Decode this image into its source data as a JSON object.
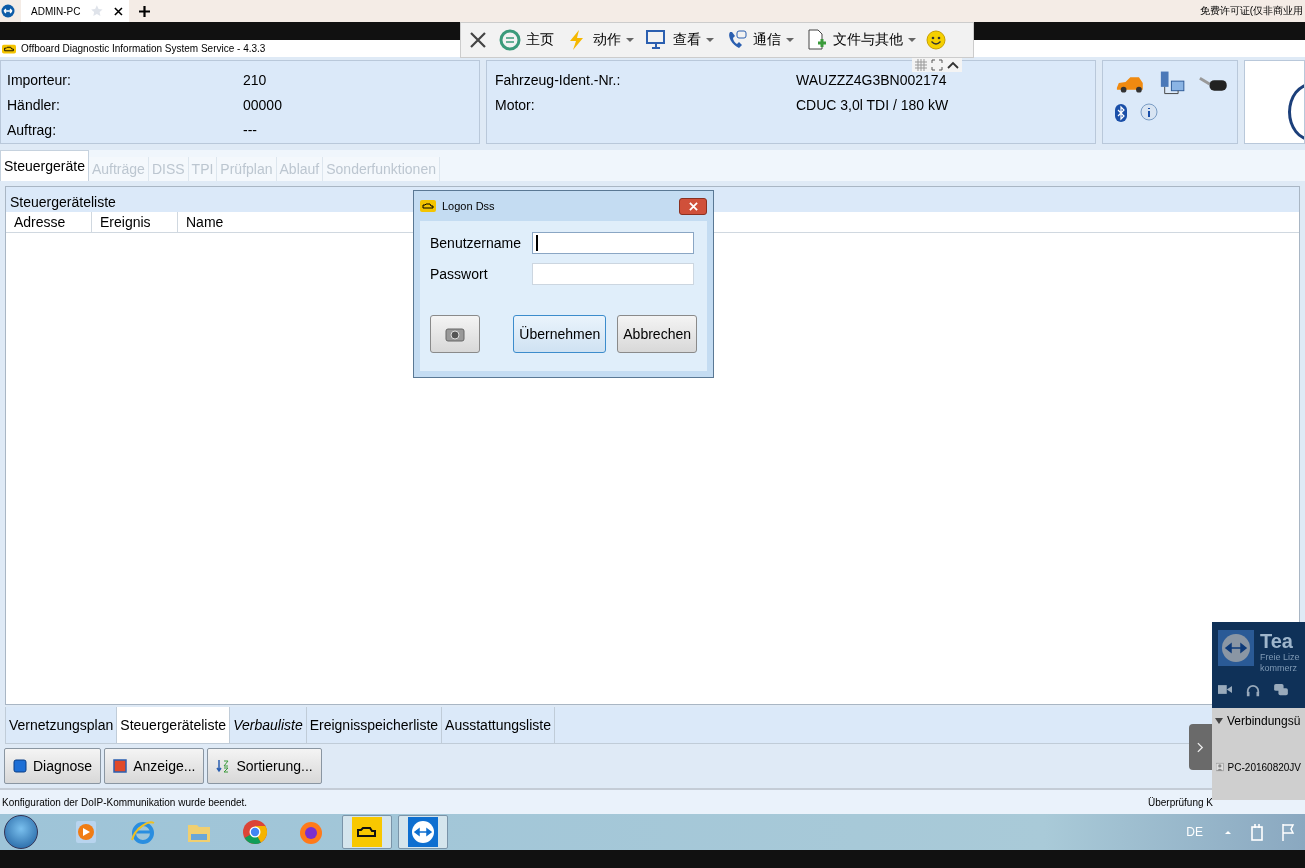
{
  "browser": {
    "tab": "ADMIN-PC",
    "notice": "免费许可证(仅非商业用"
  },
  "remote_toolbar": {
    "items": [
      {
        "label": "主页",
        "dropdown": false
      },
      {
        "label": "动作",
        "dropdown": true
      },
      {
        "label": "查看",
        "dropdown": true
      },
      {
        "label": "通信",
        "dropdown": true
      },
      {
        "label": "文件与其他",
        "dropdown": true
      }
    ]
  },
  "window": {
    "title": "Offboard Diagnostic Information System Service - 4.3.3"
  },
  "order_info": [
    {
      "label": "Importeur:",
      "value": "210"
    },
    {
      "label": "Händler:",
      "value": "00000"
    },
    {
      "label": "Auftrag:",
      "value": "---"
    }
  ],
  "vehicle_info": [
    {
      "label": "Fahrzeug-Ident.-Nr.:",
      "value": "WAUZZZ4G3BN002174"
    },
    {
      "label": "Motor:",
      "value": "CDUC 3,0l TDI / 180 kW"
    }
  ],
  "tabs": [
    {
      "label": "Steuergeräte",
      "selected": true,
      "disabled": false
    },
    {
      "label": "Aufträge",
      "selected": false,
      "disabled": true
    },
    {
      "label": "DISS",
      "selected": false,
      "disabled": true
    },
    {
      "label": "TPI",
      "selected": false,
      "disabled": true
    },
    {
      "label": "Prüfplan",
      "selected": false,
      "disabled": true
    },
    {
      "label": "Ablauf",
      "selected": false,
      "disabled": true
    },
    {
      "label": "Sonderfunktionen",
      "selected": false,
      "disabled": true
    }
  ],
  "panel": {
    "title": "Steuergeräteliste",
    "columns": [
      "Adresse",
      "Ereignis",
      "Name"
    ]
  },
  "view_tabs": [
    {
      "label": "Vernetzungsplan",
      "selected": false,
      "italic": false
    },
    {
      "label": "Steuergeräteliste",
      "selected": true,
      "italic": false
    },
    {
      "label": "Verbauliste",
      "selected": false,
      "italic": true
    },
    {
      "label": "Ereignisspeicherliste",
      "selected": false,
      "italic": false
    },
    {
      "label": "Ausstattungsliste",
      "selected": false,
      "italic": false
    }
  ],
  "actions": [
    {
      "label": "Diagnose"
    },
    {
      "label": "Anzeige..."
    },
    {
      "label": "Sortierung..."
    }
  ],
  "status_bar": {
    "message": "Konfiguration der DoIP-Kommunikation wurde beendet.",
    "right": "Überprüfung K"
  },
  "taskbar": {
    "apps": [
      {
        "kind": "media",
        "active": false
      },
      {
        "kind": "ie",
        "active": false
      },
      {
        "kind": "folder",
        "active": false
      },
      {
        "kind": "chrome",
        "active": false
      },
      {
        "kind": "firefox",
        "active": false
      },
      {
        "kind": "engine",
        "active": true
      },
      {
        "kind": "teamviewer",
        "active": true
      }
    ],
    "language": "DE"
  },
  "dialog": {
    "title": "Logon Dss",
    "fields": [
      {
        "label": "Benutzername",
        "focused": true
      },
      {
        "label": "Passwort",
        "focused": false
      }
    ],
    "buttons": [
      {
        "label": "Übernehmen",
        "default": true
      },
      {
        "label": "Abbrechen",
        "default": false
      }
    ]
  },
  "teamviewer": {
    "title": "Tea",
    "subtitle": [
      "Freie Lize",
      "kommerz"
    ],
    "section": "Verbindungsü",
    "contact": "PC-20160820JV"
  }
}
